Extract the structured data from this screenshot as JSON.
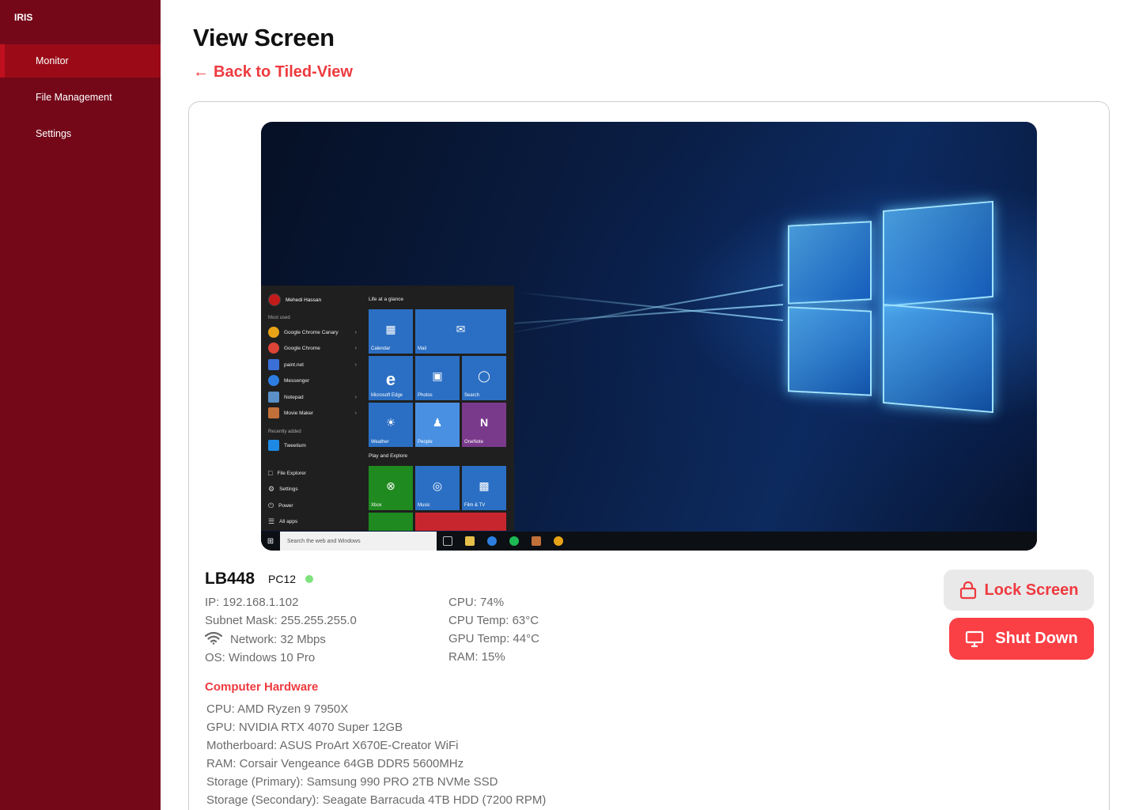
{
  "app": {
    "name": "IRIS"
  },
  "sidebar": {
    "items": [
      {
        "label": "Monitor",
        "active": true
      },
      {
        "label": "File Management",
        "active": false
      },
      {
        "label": "Settings",
        "active": false
      }
    ]
  },
  "header": {
    "title": "View Screen",
    "back_label": "Back to Tiled-View"
  },
  "screen_preview": {
    "start_menu": {
      "user": "Mehedi Hassan",
      "most_used_label": "Most used",
      "most_used": [
        "Google Chrome Canary",
        "Google Chrome",
        "paint.net",
        "Messenger",
        "Notepad",
        "Movie Maker"
      ],
      "recently_added_label": "Recently added",
      "recently_added": [
        "Tweetium"
      ],
      "system": [
        "File Explorer",
        "Settings",
        "Power",
        "All apps"
      ],
      "glance_label": "Life at a glance",
      "play_label": "Play and Explore",
      "tiles": [
        "Calendar",
        "Mail",
        "Microsoft Edge",
        "Photos",
        "Search",
        "Weather",
        "People",
        "OneNote",
        "Xbox",
        "Music",
        "Film & TV"
      ]
    },
    "taskbar": {
      "search_placeholder": "Search the web and Windows"
    }
  },
  "device": {
    "name": "LB448",
    "label": "PC12",
    "status_color": "#7de37b",
    "ip": "IP: 192.168.1.102",
    "subnet": "Subnet Mask: 255.255.255.0",
    "network": "Network: 32 Mbps",
    "os": "OS: Windows 10 Pro",
    "cpu": "CPU: 74%",
    "cpu_temp": "CPU Temp: 63°C",
    "gpu_temp": "GPU Temp: 44°C",
    "ram": "RAM: 15%"
  },
  "hardware": {
    "title": "Computer Hardware",
    "items": [
      "CPU: AMD Ryzen 9 7950X",
      "GPU: NVIDIA RTX 4070 Super 12GB",
      "Motherboard: ASUS ProArt X670E-Creator WiFi",
      "RAM: Corsair Vengeance 64GB DDR5 5600MHz",
      "Storage (Primary): Samsung 990 PRO 2TB NVMe SSD",
      "Storage (Secondary): Seagate Barracuda 4TB HDD (7200 RPM)"
    ]
  },
  "actions": {
    "lock_label": "Lock Screen",
    "shutdown_label": "Shut Down"
  },
  "colors": {
    "sidebar": "#740819",
    "accent": "#ee3a3f",
    "danger": "#fa3f45"
  }
}
